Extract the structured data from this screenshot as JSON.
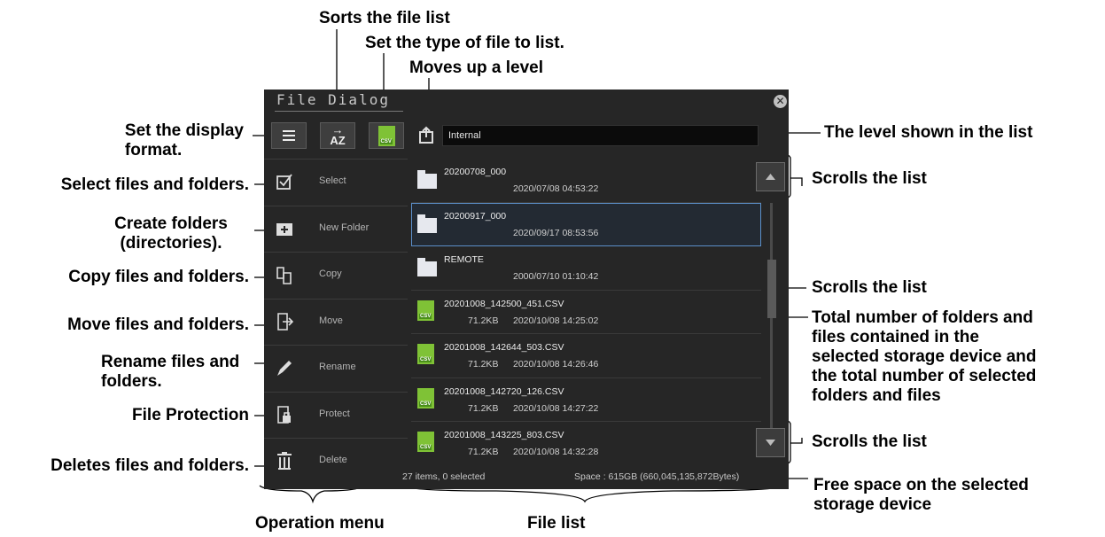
{
  "dialog": {
    "title": "File Dialog",
    "path": "Internal",
    "toolbar": {
      "display_format_icon": "list-icon",
      "sort_icon": "sort-az-icon",
      "filter_icon": "csv-icon",
      "up_icon": "folder-up-icon"
    },
    "menu": [
      {
        "label": "Select",
        "icon": "checkbox-icon"
      },
      {
        "label": "New Folder",
        "icon": "new-folder-icon"
      },
      {
        "label": "Copy",
        "icon": "copy-icon"
      },
      {
        "label": "Move",
        "icon": "move-icon"
      },
      {
        "label": "Rename",
        "icon": "pencil-icon"
      },
      {
        "label": "Protect",
        "icon": "lock-icon"
      },
      {
        "label": "Delete",
        "icon": "trash-icon"
      }
    ],
    "files": [
      {
        "name": "20200708_000",
        "size": "",
        "date": "2020/07/08  04:53:22",
        "type": "folder"
      },
      {
        "name": "20200917_000",
        "size": "",
        "date": "2020/09/17  08:53:56",
        "type": "folder"
      },
      {
        "name": "REMOTE",
        "size": "",
        "date": "2000/07/10  01:10:42",
        "type": "folder"
      },
      {
        "name": "20201008_142500_451.CSV",
        "size": "71.2KB",
        "date": "2020/10/08  14:25:02",
        "type": "csv"
      },
      {
        "name": "20201008_142644_503.CSV",
        "size": "71.2KB",
        "date": "2020/10/08  14:26:46",
        "type": "csv"
      },
      {
        "name": "20201008_142720_126.CSV",
        "size": "71.2KB",
        "date": "2020/10/08  14:27:22",
        "type": "csv"
      },
      {
        "name": "20201008_143225_803.CSV",
        "size": "71.2KB",
        "date": "2020/10/08  14:32:28",
        "type": "csv"
      }
    ],
    "status_items": "27 items,  0 selected",
    "status_space": "Space : 615GB (660,045,135,872Bytes)",
    "csv_badge": "CSV"
  },
  "annotations": {
    "sorts": "Sorts the file list",
    "set_type": "Set the type of file to list.",
    "moves_up": "Moves up a level",
    "display_format_1": "Set the display",
    "display_format_2": "format.",
    "select": "Select files and folders.",
    "create_1": "Create folders",
    "create_2": "(directories).",
    "copy": "Copy files and folders.",
    "move": "Move files and folders.",
    "rename_1": "Rename files and",
    "rename_2": "folders.",
    "protect": "File Protection",
    "delete": "Deletes files and folders.",
    "level": "The level shown in the list",
    "scroll_up": "Scrolls the list",
    "scroll_mid": "Scrolls the list",
    "total_1": "Total number of folders and",
    "total_2": "files contained in the",
    "total_3": "selected storage device and",
    "total_4": "the total number of selected",
    "total_5": "folders and files",
    "scroll_down": "Scrolls the list",
    "free_1": "Free space on the selected",
    "free_2": "storage device",
    "operation_menu": "Operation menu",
    "file_list": "File list"
  }
}
